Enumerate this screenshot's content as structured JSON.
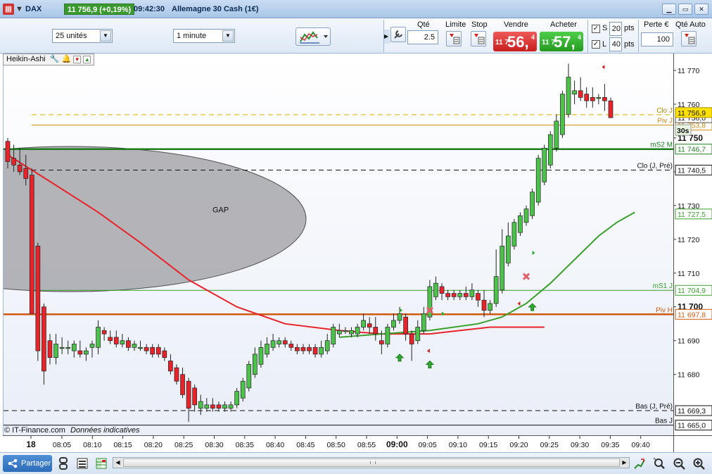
{
  "titlebar": {
    "instrument": "DAX",
    "last_price": "11 756,9 (+0,19%)",
    "time": "09:42:30",
    "market_name": "Allemagne 30 Cash (1€)"
  },
  "toolbar": {
    "units_select": "25 unités",
    "interval_select": "1 minute",
    "qty_label": "Qté",
    "qty_value": "2.5",
    "limit_label": "Limite",
    "stop_label": "Stop",
    "sell_label": "Vendre",
    "buy_label": "Acheter",
    "sell_price_small": "11 7",
    "sell_price_big": "56,",
    "sell_price_sup": "4",
    "buy_price_small": "11 7",
    "buy_price_big": "57,",
    "buy_price_sup": "4",
    "s_label": "S",
    "s_value": "20",
    "l_label": "L",
    "l_value": "40",
    "pts_label": "pts",
    "loss_label": "Perte €",
    "loss_value": "100",
    "qty_auto_label": "Qté Auto"
  },
  "chart": {
    "indicator_tag": "Heikin-Ashi",
    "gap_label": "GAP",
    "footer_copyright": "© IT-Finance.com",
    "footer_note": "Données indicatives",
    "colors": {
      "bull": "#4cc24a",
      "bear": "#e8232a",
      "ma": "#e8232a",
      "ma2": "#3aa02c",
      "gap": "#a8a8ad"
    }
  },
  "levels": [
    {
      "name": "Clo J",
      "price": "11 756,9",
      "value": 11756.9,
      "color": "#d6b400",
      "dash": true,
      "axis_bg": "#ffe100"
    },
    {
      "name": "Piv J",
      "price": "11 753,8",
      "value": 11753.8,
      "color": "#d08b10",
      "dash": false,
      "axis_bg": "#ffffff"
    },
    {
      "name": "mS2 M",
      "price": "11 746,7",
      "value": 11746.7,
      "color": "#1e7d1e",
      "dash": false,
      "axis_bg": "#ffffff",
      "thick": true
    },
    {
      "name": "Clo (J, Pré)",
      "price": "11 740,5",
      "value": 11740.5,
      "color": "#111111",
      "dash": true,
      "axis_bg": "#ffffff"
    },
    {
      "name": "mS1 J",
      "price": "11 704,9",
      "value": 11704.9,
      "color": "#3aa02c",
      "dash": false,
      "axis_bg": "#ffffff"
    },
    {
      "name": "Piv H",
      "price": "11 697,8",
      "value": 11697.8,
      "color": "#d05a10",
      "dash": false,
      "axis_bg": "#ffffff",
      "thick": true
    },
    {
      "name": "Bas (J, Pré)",
      "price": "11 669,3",
      "value": 11669.3,
      "color": "#111111",
      "dash": true,
      "axis_bg": "#ffffff"
    },
    {
      "name": "Bas J",
      "price": "11 665,0",
      "value": 11665.0,
      "color": "#111111",
      "dash": false,
      "axis_bg": "#ffffff"
    }
  ],
  "price_axis": {
    "ticks": [
      "11 770",
      "11 760",
      "11 750",
      "11 740",
      "11 730",
      "11 720",
      "11 710",
      "11 700",
      "11 690",
      "11 680"
    ],
    "tick_values": [
      11770,
      11760,
      11750,
      11740,
      11730,
      11720,
      11710,
      11700,
      11690,
      11680
    ],
    "bold_ticks": [
      "11 750",
      "11 700"
    ],
    "current_price": "11 756,0",
    "current_price_value": 11756.0,
    "ma_price": "11 727,5",
    "ma_price_value": 11727.5,
    "timer": "30s"
  },
  "time_axis": {
    "labels": [
      "18",
      "08:05",
      "08:10",
      "08:15",
      "08:20",
      "08:25",
      "08:30",
      "08:35",
      "08:40",
      "08:45",
      "08:50",
      "08:55",
      "09:00",
      "09:05",
      "09:10",
      "09:15",
      "09:20",
      "09:25",
      "09:30",
      "09:35",
      "09:40"
    ],
    "bold_labels": [
      "18",
      "09:00"
    ]
  },
  "bottombar": {
    "share_label": "Partager"
  },
  "chart_data": {
    "type": "candlestick",
    "title": "",
    "xlabel": "",
    "ylabel": "",
    "ylim": [
      11662,
      11775
    ],
    "x_start": "08:00",
    "x_end": "09:42",
    "candles": [
      {
        "o": 11749,
        "h": 11750,
        "l": 11741,
        "c": 11743
      },
      {
        "o": 11744,
        "h": 11748,
        "l": 11740,
        "c": 11742
      },
      {
        "o": 11742,
        "h": 11747,
        "l": 11739,
        "c": 11740
      },
      {
        "o": 11741,
        "h": 11745,
        "l": 11736,
        "c": 11738
      },
      {
        "o": 11739,
        "h": 11741,
        "l": 11698,
        "c": 11698
      },
      {
        "o": 11718,
        "h": 11719,
        "l": 11684,
        "c": 11687
      },
      {
        "o": 11700,
        "h": 11701,
        "l": 11677,
        "c": 11681
      },
      {
        "o": 11690,
        "h": 11692,
        "l": 11683,
        "c": 11685
      },
      {
        "o": 11685,
        "h": 11692,
        "l": 11683,
        "c": 11689
      },
      {
        "o": 11688,
        "h": 11691,
        "l": 11686,
        "c": 11688
      },
      {
        "o": 11688,
        "h": 11690,
        "l": 11686,
        "c": 11688
      },
      {
        "o": 11687,
        "h": 11690,
        "l": 11685,
        "c": 11689
      },
      {
        "o": 11687,
        "h": 11690,
        "l": 11685,
        "c": 11686
      },
      {
        "o": 11686,
        "h": 11688,
        "l": 11684,
        "c": 11687
      },
      {
        "o": 11688,
        "h": 11690,
        "l": 11685,
        "c": 11689
      },
      {
        "o": 11688,
        "h": 11696,
        "l": 11686,
        "c": 11694
      },
      {
        "o": 11693,
        "h": 11694,
        "l": 11690,
        "c": 11692
      },
      {
        "o": 11691,
        "h": 11693,
        "l": 11689,
        "c": 11690
      },
      {
        "o": 11691,
        "h": 11693,
        "l": 11688,
        "c": 11689
      },
      {
        "o": 11689,
        "h": 11692,
        "l": 11688,
        "c": 11690
      },
      {
        "o": 11690,
        "h": 11691,
        "l": 11687,
        "c": 11688
      },
      {
        "o": 11688,
        "h": 11690,
        "l": 11687,
        "c": 11689
      },
      {
        "o": 11688,
        "h": 11690,
        "l": 11687,
        "c": 11688
      },
      {
        "o": 11688,
        "h": 11689,
        "l": 11686,
        "c": 11687
      },
      {
        "o": 11688,
        "h": 11689,
        "l": 11685,
        "c": 11686
      },
      {
        "o": 11688,
        "h": 11689,
        "l": 11685,
        "c": 11686
      },
      {
        "o": 11687,
        "h": 11688,
        "l": 11684,
        "c": 11685
      },
      {
        "o": 11684,
        "h": 11686,
        "l": 11680,
        "c": 11681
      },
      {
        "o": 11682,
        "h": 11683,
        "l": 11677,
        "c": 11678
      },
      {
        "o": 11680,
        "h": 11682,
        "l": 11673,
        "c": 11674
      },
      {
        "o": 11678,
        "h": 11679,
        "l": 11666,
        "c": 11670
      },
      {
        "o": 11676,
        "h": 11677,
        "l": 11669,
        "c": 11671
      },
      {
        "o": 11670,
        "h": 11674,
        "l": 11668,
        "c": 11672
      },
      {
        "o": 11670,
        "h": 11673,
        "l": 11669,
        "c": 11671
      },
      {
        "o": 11671,
        "h": 11673,
        "l": 11669,
        "c": 11670
      },
      {
        "o": 11671,
        "h": 11672,
        "l": 11669,
        "c": 11670
      },
      {
        "o": 11670,
        "h": 11672,
        "l": 11669,
        "c": 11671
      },
      {
        "o": 11670,
        "h": 11672,
        "l": 11669,
        "c": 11671
      },
      {
        "o": 11671,
        "h": 11676,
        "l": 11670,
        "c": 11675
      },
      {
        "o": 11673,
        "h": 11679,
        "l": 11672,
        "c": 11678
      },
      {
        "o": 11676,
        "h": 11684,
        "l": 11675,
        "c": 11683
      },
      {
        "o": 11680,
        "h": 11688,
        "l": 11679,
        "c": 11686
      },
      {
        "o": 11683,
        "h": 11690,
        "l": 11682,
        "c": 11688
      },
      {
        "o": 11686,
        "h": 11691,
        "l": 11685,
        "c": 11689
      },
      {
        "o": 11688,
        "h": 11692,
        "l": 11687,
        "c": 11690
      },
      {
        "o": 11689,
        "h": 11691,
        "l": 11688,
        "c": 11690
      },
      {
        "o": 11690,
        "h": 11691,
        "l": 11688,
        "c": 11689
      },
      {
        "o": 11689,
        "h": 11690,
        "l": 11687,
        "c": 11688
      },
      {
        "o": 11688,
        "h": 11689,
        "l": 11686,
        "c": 11687
      },
      {
        "o": 11688,
        "h": 11689,
        "l": 11686,
        "c": 11687
      },
      {
        "o": 11688,
        "h": 11689,
        "l": 11686,
        "c": 11687
      },
      {
        "o": 11688,
        "h": 11689,
        "l": 11685,
        "c": 11686
      },
      {
        "o": 11686,
        "h": 11690,
        "l": 11685,
        "c": 11688
      },
      {
        "o": 11687,
        "h": 11692,
        "l": 11686,
        "c": 11690
      },
      {
        "o": 11689,
        "h": 11695,
        "l": 11688,
        "c": 11694
      },
      {
        "o": 11692,
        "h": 11695,
        "l": 11691,
        "c": 11693
      },
      {
        "o": 11693,
        "h": 11694,
        "l": 11692,
        "c": 11693
      },
      {
        "o": 11692,
        "h": 11694,
        "l": 11691,
        "c": 11693
      },
      {
        "o": 11692,
        "h": 11695,
        "l": 11691,
        "c": 11694
      },
      {
        "o": 11694,
        "h": 11698,
        "l": 11693,
        "c": 11696
      },
      {
        "o": 11695,
        "h": 11697,
        "l": 11692,
        "c": 11694
      },
      {
        "o": 11694,
        "h": 11697,
        "l": 11690,
        "c": 11692
      },
      {
        "o": 11690,
        "h": 11693,
        "l": 11686,
        "c": 11689
      },
      {
        "o": 11689,
        "h": 11695,
        "l": 11688,
        "c": 11694
      },
      {
        "o": 11694,
        "h": 11698,
        "l": 11693,
        "c": 11696
      },
      {
        "o": 11696,
        "h": 11700,
        "l": 11695,
        "c": 11698
      },
      {
        "o": 11697,
        "h": 11698,
        "l": 11690,
        "c": 11692
      },
      {
        "o": 11692,
        "h": 11693,
        "l": 11684,
        "c": 11689
      },
      {
        "o": 11690,
        "h": 11696,
        "l": 11689,
        "c": 11694
      },
      {
        "o": 11693,
        "h": 11700,
        "l": 11692,
        "c": 11698
      },
      {
        "o": 11697,
        "h": 11708,
        "l": 11696,
        "c": 11706
      },
      {
        "o": 11703,
        "h": 11709,
        "l": 11702,
        "c": 11707
      },
      {
        "o": 11706,
        "h": 11707,
        "l": 11702,
        "c": 11704
      },
      {
        "o": 11704,
        "h": 11705,
        "l": 11702,
        "c": 11703
      },
      {
        "o": 11704,
        "h": 11705,
        "l": 11702,
        "c": 11703
      },
      {
        "o": 11703,
        "h": 11705,
        "l": 11702,
        "c": 11704
      },
      {
        "o": 11704,
        "h": 11706,
        "l": 11702,
        "c": 11703
      },
      {
        "o": 11703,
        "h": 11707,
        "l": 11702,
        "c": 11705
      },
      {
        "o": 11704,
        "h": 11705,
        "l": 11700,
        "c": 11702
      },
      {
        "o": 11702,
        "h": 11705,
        "l": 11697,
        "c": 11699
      },
      {
        "o": 11699,
        "h": 11702,
        "l": 11698,
        "c": 11701
      },
      {
        "o": 11701,
        "h": 11717,
        "l": 11700,
        "c": 11709
      },
      {
        "o": 11705,
        "h": 11723,
        "l": 11704,
        "c": 11718
      },
      {
        "o": 11713,
        "h": 11725,
        "l": 11712,
        "c": 11721
      },
      {
        "o": 11718,
        "h": 11726,
        "l": 11717,
        "c": 11725
      },
      {
        "o": 11722,
        "h": 11728,
        "l": 11721,
        "c": 11727
      },
      {
        "o": 11725,
        "h": 11730,
        "l": 11724,
        "c": 11729
      },
      {
        "o": 11727,
        "h": 11735,
        "l": 11726,
        "c": 11734
      },
      {
        "o": 11731,
        "h": 11745,
        "l": 11730,
        "c": 11744
      },
      {
        "o": 11737,
        "h": 11748,
        "l": 11736,
        "c": 11747
      },
      {
        "o": 11742,
        "h": 11752,
        "l": 11741,
        "c": 11751
      },
      {
        "o": 11747,
        "h": 11757,
        "l": 11746,
        "c": 11755
      },
      {
        "o": 11751,
        "h": 11764,
        "l": 11750,
        "c": 11763
      },
      {
        "o": 11757,
        "h": 11772,
        "l": 11756,
        "c": 11768
      },
      {
        "o": 11763,
        "h": 11767,
        "l": 11760,
        "c": 11764
      },
      {
        "o": 11764,
        "h": 11768,
        "l": 11761,
        "c": 11762
      },
      {
        "o": 11763,
        "h": 11765,
        "l": 11759,
        "c": 11761
      },
      {
        "o": 11762,
        "h": 11765,
        "l": 11759,
        "c": 11761
      },
      {
        "o": 11762,
        "h": 11763,
        "l": 11760,
        "c": 11762
      },
      {
        "o": 11762,
        "h": 11766,
        "l": 11758,
        "c": 11761
      },
      {
        "o": 11761,
        "h": 11762,
        "l": 11756,
        "c": 11756
      }
    ],
    "ma_red": [
      [
        0,
        11745
      ],
      [
        8,
        11736
      ],
      [
        15,
        11728
      ],
      [
        22,
        11719
      ],
      [
        30,
        11708
      ],
      [
        38,
        11700
      ],
      [
        46,
        11695
      ],
      [
        55,
        11693
      ],
      [
        62,
        11692
      ],
      [
        70,
        11692
      ],
      [
        80,
        11694
      ],
      [
        89,
        11694
      ]
    ],
    "ma_green": [
      [
        55,
        11691
      ],
      [
        62,
        11692
      ],
      [
        70,
        11693
      ],
      [
        78,
        11695
      ],
      [
        82,
        11697
      ],
      [
        86,
        11701
      ],
      [
        90,
        11707
      ],
      [
        94,
        11714
      ],
      [
        98,
        11721
      ],
      [
        101,
        11725
      ],
      [
        104,
        11728
      ]
    ]
  }
}
